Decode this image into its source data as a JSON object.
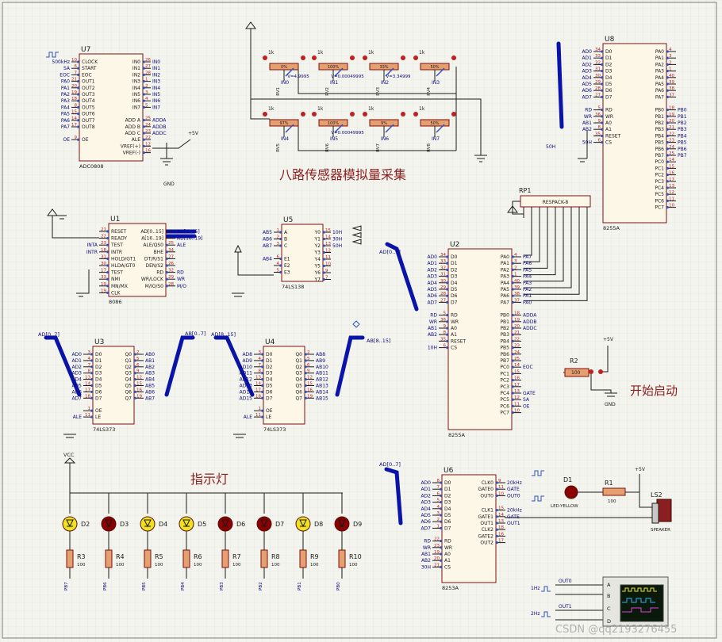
{
  "titles": {
    "sensor": "八路传感器模拟量采集",
    "start": "开始启动",
    "lights": "指示灯"
  },
  "watermark": "CSDN @qq2193276455",
  "colors": {
    "wire": "#1a1a1a",
    "bus": "#0a14a8",
    "chip": "#fdf7e8",
    "chip_border": "#7a1010",
    "pin_blue": "#3050c0",
    "pin_red": "#c02020",
    "label": "#0a0a7a",
    "title": "#8b1e1e",
    "led_red": "#8b0000",
    "led_yellow": "#f0e020"
  },
  "chips": {
    "u7": {
      "ref": "U7",
      "part": "ADC0808",
      "left": [
        [
          "10",
          "CLOCK"
        ],
        [
          "6",
          "START"
        ],
        [
          "7",
          "EOC"
        ],
        [
          "21",
          "OUT1"
        ],
        [
          "20",
          "OUT2"
        ],
        [
          "19",
          "OUT3"
        ],
        [
          "18",
          "OUT4"
        ],
        [
          "8",
          "OUT5"
        ],
        [
          "15",
          "OUT6"
        ],
        [
          "14",
          "OUT7"
        ],
        [
          "17",
          "OUT8"
        ],
        [
          "9",
          "OE"
        ]
      ],
      "right": [
        [
          "26",
          "IN0"
        ],
        [
          "27",
          "IN1"
        ],
        [
          "28",
          "IN2"
        ],
        [
          "1",
          "IN3"
        ],
        [
          "2",
          "IN4"
        ],
        [
          "3",
          "IN5"
        ],
        [
          "4",
          "IN6"
        ],
        [
          "5",
          "IN7"
        ],
        [
          "25",
          "ADD A"
        ],
        [
          "24",
          "ADD B"
        ],
        [
          "23",
          "ADD C"
        ],
        [
          "22",
          "ALE"
        ],
        [
          "12",
          "VREF(+)"
        ],
        [
          "16",
          "VREF(-)"
        ]
      ]
    },
    "u8": {
      "ref": "U8",
      "part": "8255A",
      "left": [
        [
          "34",
          "D0"
        ],
        [
          "33",
          "D1"
        ],
        [
          "32",
          "D2"
        ],
        [
          "31",
          "D3"
        ],
        [
          "30",
          "D4"
        ],
        [
          "29",
          "D5"
        ],
        [
          "28",
          "D6"
        ],
        [
          "27",
          "D7"
        ],
        [
          "5",
          "RD"
        ],
        [
          "36",
          "WR"
        ],
        [
          "9",
          "A0"
        ],
        [
          "8",
          "A1"
        ],
        [
          "35",
          "RESET"
        ],
        [
          "6",
          "CS"
        ]
      ],
      "right": [
        [
          "4",
          "PA0"
        ],
        [
          "3",
          "PA1"
        ],
        [
          "2",
          "PA2"
        ],
        [
          "1",
          "PA3"
        ],
        [
          "40",
          "PA4"
        ],
        [
          "39",
          "PA5"
        ],
        [
          "38",
          "PA6"
        ],
        [
          "37",
          "PA7"
        ],
        [
          "18",
          "PB0"
        ],
        [
          "19",
          "PB1"
        ],
        [
          "20",
          "PB2"
        ],
        [
          "21",
          "PB3"
        ],
        [
          "22",
          "PB4"
        ],
        [
          "23",
          "PB5"
        ],
        [
          "24",
          "PB6"
        ],
        [
          "25",
          "PB7"
        ],
        [
          "14",
          "PC0"
        ],
        [
          "15",
          "PC1"
        ],
        [
          "16",
          "PC2"
        ],
        [
          "17",
          "PC3"
        ],
        [
          "13",
          "PC4"
        ],
        [
          "12",
          "PC5"
        ],
        [
          "11",
          "PC6"
        ],
        [
          "10",
          "PC7"
        ]
      ]
    },
    "u1": {
      "ref": "U1",
      "part": "8086",
      "left": [
        [
          "21",
          "RESET"
        ],
        [
          "22",
          "READY"
        ],
        [
          "23",
          "TEST"
        ],
        [
          "18",
          "INTR"
        ],
        [
          "31",
          "HOLD/GT1"
        ],
        [
          "30",
          "HLDA/GT0"
        ],
        [
          "17",
          "TEST"
        ],
        [
          "33",
          "NMI"
        ],
        [
          "19",
          "MN/MX"
        ],
        [
          "19",
          "CLK"
        ]
      ],
      "right": [
        [
          "AD[0..15]"
        ],
        [
          "A[16..19]"
        ],
        [
          "25",
          "ALE/QS0"
        ],
        [
          "34",
          "BHE"
        ],
        [
          "27",
          "DT/R/S1"
        ],
        [
          "26",
          "DEN/S2"
        ],
        [
          "32",
          "RD"
        ],
        [
          "29",
          "WR/LOCK"
        ],
        [
          "28",
          "M/IO/S0"
        ]
      ]
    },
    "u5": {
      "ref": "U5",
      "part": "74LS138",
      "left": [
        [
          "1",
          "A"
        ],
        [
          "2",
          "B"
        ],
        [
          "3",
          "C"
        ],
        [
          "6",
          "E1"
        ],
        [
          "4",
          "E2"
        ],
        [
          "5",
          "E3"
        ]
      ],
      "right": [
        [
          "15",
          "Y0"
        ],
        [
          "14",
          "Y1"
        ],
        [
          "13",
          "Y2"
        ],
        [
          "12",
          "Y3"
        ],
        [
          "11",
          "Y4"
        ],
        [
          "10",
          "Y5"
        ],
        [
          "9",
          "Y6"
        ],
        [
          "7",
          "Y7"
        ]
      ]
    },
    "u2": {
      "ref": "U2",
      "part": "8255A",
      "left": [
        [
          "34",
          "D0"
        ],
        [
          "33",
          "D1"
        ],
        [
          "32",
          "D2"
        ],
        [
          "31",
          "D3"
        ],
        [
          "30",
          "D4"
        ],
        [
          "29",
          "D5"
        ],
        [
          "28",
          "D6"
        ],
        [
          "27",
          "D7"
        ],
        [
          "5",
          "RD"
        ],
        [
          "36",
          "WR"
        ],
        [
          "9",
          "A0"
        ],
        [
          "8",
          "A1"
        ],
        [
          "35",
          "RESET"
        ],
        [
          "6",
          "CS"
        ]
      ],
      "right": [
        [
          "4",
          "PA0"
        ],
        [
          "3",
          "PA1"
        ],
        [
          "2",
          "PA2"
        ],
        [
          "1",
          "PA3"
        ],
        [
          "40",
          "PA4"
        ],
        [
          "39",
          "PA5"
        ],
        [
          "38",
          "PA6"
        ],
        [
          "37",
          "PA7"
        ],
        [
          "18",
          "PB0"
        ],
        [
          "19",
          "PB1"
        ],
        [
          "20",
          "PB2"
        ],
        [
          "21",
          "PB3"
        ],
        [
          "22",
          "PB4"
        ],
        [
          "23",
          "PB5"
        ],
        [
          "24",
          "PB6"
        ],
        [
          "25",
          "PB7"
        ],
        [
          "14",
          "PC0"
        ],
        [
          "15",
          "PC1"
        ],
        [
          "16",
          "PC2"
        ],
        [
          "17",
          "PC3"
        ],
        [
          "13",
          "PC4"
        ],
        [
          "12",
          "PC5"
        ],
        [
          "11",
          "PC6"
        ],
        [
          "10",
          "PC7"
        ]
      ]
    },
    "u3": {
      "ref": "U3",
      "part": "74LS373",
      "left": [
        [
          "3",
          "D0"
        ],
        [
          "4",
          "D1"
        ],
        [
          "7",
          "D2"
        ],
        [
          "8",
          "D3"
        ],
        [
          "13",
          "D4"
        ],
        [
          "14",
          "D5"
        ],
        [
          "17",
          "D6"
        ],
        [
          "18",
          "D7"
        ],
        [
          "1",
          "OE"
        ],
        [
          "11",
          "LE"
        ]
      ],
      "right": [
        [
          "2",
          "Q0"
        ],
        [
          "5",
          "Q1"
        ],
        [
          "6",
          "Q2"
        ],
        [
          "9",
          "Q3"
        ],
        [
          "12",
          "Q4"
        ],
        [
          "15",
          "Q5"
        ],
        [
          "16",
          "Q6"
        ],
        [
          "19",
          "Q7"
        ]
      ]
    },
    "u4": {
      "ref": "U4",
      "part": "74LS373",
      "left": [
        [
          "3",
          "D0"
        ],
        [
          "4",
          "D1"
        ],
        [
          "7",
          "D2"
        ],
        [
          "8",
          "D3"
        ],
        [
          "13",
          "D4"
        ],
        [
          "14",
          "D5"
        ],
        [
          "17",
          "D6"
        ],
        [
          "18",
          "D7"
        ],
        [
          "1",
          "OE"
        ],
        [
          "11",
          "LE"
        ]
      ],
      "right": [
        [
          "2",
          "Q0"
        ],
        [
          "5",
          "Q1"
        ],
        [
          "6",
          "Q2"
        ],
        [
          "9",
          "Q3"
        ],
        [
          "12",
          "Q4"
        ],
        [
          "15",
          "Q5"
        ],
        [
          "16",
          "Q6"
        ],
        [
          "19",
          "Q7"
        ]
      ]
    },
    "u6": {
      "ref": "U6",
      "part": "8253A",
      "left": [
        [
          "8",
          "D0"
        ],
        [
          "7",
          "D1"
        ],
        [
          "6",
          "D2"
        ],
        [
          "5",
          "D3"
        ],
        [
          "4",
          "D4"
        ],
        [
          "3",
          "D5"
        ],
        [
          "2",
          "D6"
        ],
        [
          "1",
          "D7"
        ],
        [
          "22",
          "RD"
        ],
        [
          "23",
          "WR"
        ],
        [
          "19",
          "A0"
        ],
        [
          "20",
          "A1"
        ],
        [
          "21",
          "CS"
        ]
      ],
      "right": [
        [
          "9",
          "CLK0"
        ],
        [
          "11",
          "GATE0"
        ],
        [
          "10",
          "OUT0"
        ],
        [
          "15",
          "CLK1"
        ],
        [
          "14",
          "GATE1"
        ],
        [
          "13",
          "OUT1"
        ],
        [
          "18",
          "CLK2"
        ],
        [
          "16",
          "GATE2"
        ],
        [
          "17",
          "OUT2"
        ]
      ]
    }
  },
  "u7_left_nets": [
    "500kHz",
    "SA",
    "EOC",
    "PA0",
    "PA1",
    "PA2",
    "PA3",
    "PA4",
    "PA5",
    "PA6",
    "PA7",
    "OE"
  ],
  "u7_right_nets": [
    "IN0",
    "IN1",
    "IN2",
    "IN3",
    "IN4",
    "IN5",
    "IN6",
    "IN7",
    "ADDA",
    "ADDB",
    "ADDC",
    "",
    "",
    ""
  ],
  "u8_left_nets": [
    "AD0",
    "AD1",
    "AD2",
    "AD3",
    "AD4",
    "AD5",
    "AD6",
    "AD7",
    "RD",
    "WR",
    "AB1",
    "AB2",
    "",
    "50H"
  ],
  "u8_right_nets": [
    "",
    "",
    "",
    "",
    "",
    "",
    "",
    "",
    "PB0",
    "PB1",
    "PB2",
    "PB3",
    "PB4",
    "PB5",
    "PB6",
    "PB7"
  ],
  "u1_left_nets": [
    "",
    "",
    "INTA",
    "INTR",
    "",
    "",
    "",
    "",
    "",
    ""
  ],
  "u1_right_nets": [
    "AD[0..15]",
    "AD[16..19]",
    "ALE",
    "",
    "",
    "",
    "RD",
    "WR",
    "M/O"
  ],
  "u5_left_nets": [
    "AB5",
    "AB6",
    "AB7",
    "AB4",
    "",
    ""
  ],
  "u5_right_nets": [
    "10H",
    "30H",
    "50H",
    "",
    "",
    "",
    "",
    ""
  ],
  "u2_left_nets": [
    "AD0",
    "AD1",
    "AD2",
    "AD3",
    "AD4",
    "AD5",
    "AD6",
    "AD7",
    "RD",
    "WR",
    "AB1",
    "AB2",
    "",
    "10H"
  ],
  "u2_right_nets": [
    "PA7",
    "PA6",
    "PA5",
    "PA4",
    "PA3",
    "PA2",
    "PA1",
    "PA0",
    "ADDA",
    "ADDB",
    "ADDC",
    "",
    "",
    "",
    "",
    "",
    "EOC",
    "",
    "",
    "",
    "GATE",
    "SA",
    "OE",
    ""
  ],
  "u3_left_nets": [
    "AD0",
    "AD1",
    "AD2",
    "AD3",
    "AD4",
    "AD5",
    "AD6",
    "AD7",
    "",
    "ALE"
  ],
  "u3_right_nets": [
    "AB0",
    "AB1",
    "AB2",
    "AB3",
    "AB4",
    "AB5",
    "AB6",
    "AB7"
  ],
  "u4_left_nets": [
    "AD8",
    "AD9",
    "AD10",
    "AD11",
    "AD12",
    "AD13",
    "AD14",
    "AD15",
    "",
    "ALE"
  ],
  "u4_right_nets": [
    "AB8",
    "AB9",
    "AB10",
    "AB11",
    "AB12",
    "AB13",
    "AB14",
    "AB15"
  ],
  "u6_left_nets": [
    "AD0",
    "AD1",
    "AD2",
    "AD3",
    "AD4",
    "AD5",
    "AD6",
    "AD7",
    "RD",
    "WR",
    "AB1",
    "AB2",
    "30H"
  ],
  "u6_right_nets": [
    "20kHz",
    "GATE",
    "OUT0",
    "20kHz",
    "GATE",
    "OUT1",
    "",
    "",
    ""
  ],
  "bus_labels": {
    "u3_in": "AD[0..7]",
    "u3_out": "AB[0..7]",
    "u4_in": "AD[8..15]",
    "u4_out": "AB[8..15]",
    "u2_in": "AD[0..7]",
    "u6_in": "AD[0..7]"
  },
  "sensors": [
    {
      "ref": "RV1",
      "pct": "0%",
      "value": "V=4.9995",
      "net": "IN0",
      "k": "1k"
    },
    {
      "ref": "RV2",
      "pct": "100%",
      "value": "V=0.00049995",
      "net": "IN1",
      "k": "1k"
    },
    {
      "ref": "RV3",
      "pct": "33%",
      "value": "V=3.34999",
      "net": "IN2",
      "k": "1k"
    },
    {
      "ref": "RV4",
      "pct": "50%",
      "value": "",
      "net": "IN3",
      "k": "1k"
    },
    {
      "ref": "RV5",
      "pct": "97%",
      "value": "",
      "net": "IN4",
      "k": "1k"
    },
    {
      "ref": "RV6",
      "pct": "100%",
      "value": "V=0.00049995",
      "net": "IN5",
      "k": "1k"
    },
    {
      "ref": "RV7",
      "pct": "9%",
      "value": "",
      "net": "IN6",
      "k": "1k"
    },
    {
      "ref": "RV8",
      "pct": "50%",
      "value": "",
      "net": "IN7",
      "k": "1k"
    }
  ],
  "rp1": {
    "ref": "RP1",
    "part": "RESPACK-8"
  },
  "r2": {
    "ref": "R2",
    "value": "100"
  },
  "misc_labels": {
    "vcc": "VCC",
    "plus5v": "+5V",
    "gnd": "GND",
    "fifty_h": "50H"
  },
  "leds": [
    {
      "ref": "D2",
      "color": "yellow",
      "r": "R3",
      "rv": "100",
      "net": "PB7"
    },
    {
      "ref": "D3",
      "color": "red",
      "r": "R4",
      "rv": "100",
      "net": "PB6"
    },
    {
      "ref": "D4",
      "color": "yellow",
      "r": "R5",
      "rv": "100",
      "net": "PB5"
    },
    {
      "ref": "D5",
      "color": "yellow",
      "r": "R6",
      "rv": "100",
      "net": "PB4"
    },
    {
      "ref": "D6",
      "color": "red",
      "r": "R7",
      "rv": "100",
      "net": "PB3"
    },
    {
      "ref": "D7",
      "color": "red",
      "r": "R8",
      "rv": "100",
      "net": "PB2"
    },
    {
      "ref": "D8",
      "color": "yellow",
      "r": "R9",
      "rv": "100",
      "net": "PB1"
    },
    {
      "ref": "D9",
      "color": "red",
      "r": "R10",
      "rv": "100",
      "net": "PB0"
    }
  ],
  "buzzer": {
    "d1": "D1",
    "d1_part": "LED-YELLOW",
    "r1": "R1",
    "r1_value": "100",
    "ls": "LS2",
    "ls_part": "SPEAKER"
  },
  "scope": {
    "a": "A",
    "b": "B",
    "c": "C",
    "d": "D",
    "out0": "OUT0",
    "out1": "OUT1",
    "f1": "1Hz",
    "f2": "2Hz"
  }
}
